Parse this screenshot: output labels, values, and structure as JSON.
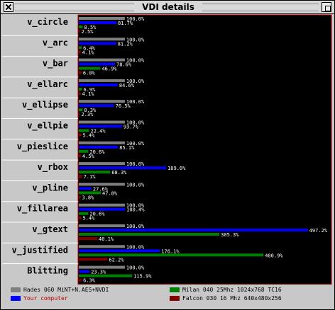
{
  "window": {
    "title": "VDI details"
  },
  "colors": {
    "hades": "#808080",
    "your": "#0000ff",
    "milan": "#008000",
    "falcon": "#800000",
    "plot_bg": "#000000",
    "plot_border": "#c00000"
  },
  "legend": {
    "hades": "Hades 060 MiNT+N.AES+NVDI",
    "your": "Your computer",
    "milan": "Milan 040 25Mhz 1024x768 TC16",
    "falcon": "Falcon 030 16 Mhz 640x480x256"
  },
  "chart_data": {
    "type": "bar",
    "title": "VDI details",
    "categories": [
      "v_circle",
      "v_arc",
      "v_bar",
      "v_ellarc",
      "v_ellipse",
      "v_ellpie",
      "v_pieslice",
      "v_rbox",
      "v_pline",
      "v_fillarea",
      "v_gtext",
      "v_justified",
      "Blitting"
    ],
    "series": [
      {
        "name": "Hades 060 MiNT+N.AES+NVDI",
        "color": "#808080",
        "values": [
          100.0,
          100.0,
          100.0,
          100.0,
          100.0,
          100.0,
          100.0,
          100.0,
          100.0,
          100.0,
          100.0,
          100.0,
          100.0
        ]
      },
      {
        "name": "Your computer",
        "color": "#0000ff",
        "values": [
          81.7,
          81.2,
          78.6,
          84.6,
          76.5,
          93.7,
          85.1,
          189.6,
          27.6,
          100.4,
          497.2,
          176.1,
          23.3
        ]
      },
      {
        "name": "Milan 040 25Mhz 1024x768 TC16",
        "color": "#008000",
        "values": [
          8.5,
          6.4,
          46.9,
          6.9,
          8.3,
          22.4,
          20.6,
          68.3,
          47.8,
          20.6,
          305.3,
          400.9,
          115.9
        ]
      },
      {
        "name": "Falcon 030 16 Mhz 640x480x256",
        "color": "#800000",
        "values": [
          2.5,
          4.1,
          6.0,
          4.1,
          2.3,
          5.4,
          4.5,
          7.1,
          3.8,
          5.4,
          40.1,
          62.2,
          6.3
        ]
      }
    ],
    "value_labels": [
      [
        "100.0%",
        "100.0%",
        "100.0%",
        "100.0%",
        "100.0%",
        "100.0%",
        "100.0%",
        "100.0%",
        "100.0%",
        "100.0%",
        "100.0%",
        "100.0%",
        "100.0%"
      ],
      [
        "81.7%",
        "81.2%",
        "78.6%",
        "84.6%",
        "76.5%",
        "93.7%",
        "85.1%",
        "189.6%",
        "27.6%",
        "100.4%",
        "497.2%",
        "176.1%",
        "23.3%"
      ],
      [
        "8.5%",
        "6.4%",
        "46.9%",
        "6.9%",
        "8.3%",
        "22.4%",
        "20.6%",
        "68.3%",
        "47.8%",
        "20.6%",
        "305.3%",
        "400.9%",
        "115.9%"
      ],
      [
        "2.5%",
        "4.1%",
        "6.0%",
        "4.1%",
        "2.3%",
        "5.4%",
        "4.5%",
        "7.1%",
        "3.8%",
        "5.4%",
        "40.1%",
        "62.2%",
        "6.3%"
      ]
    ],
    "orientation": "horizontal",
    "xlim": [
      0,
      550
    ],
    "grid": false,
    "legend_position": "bottom"
  }
}
